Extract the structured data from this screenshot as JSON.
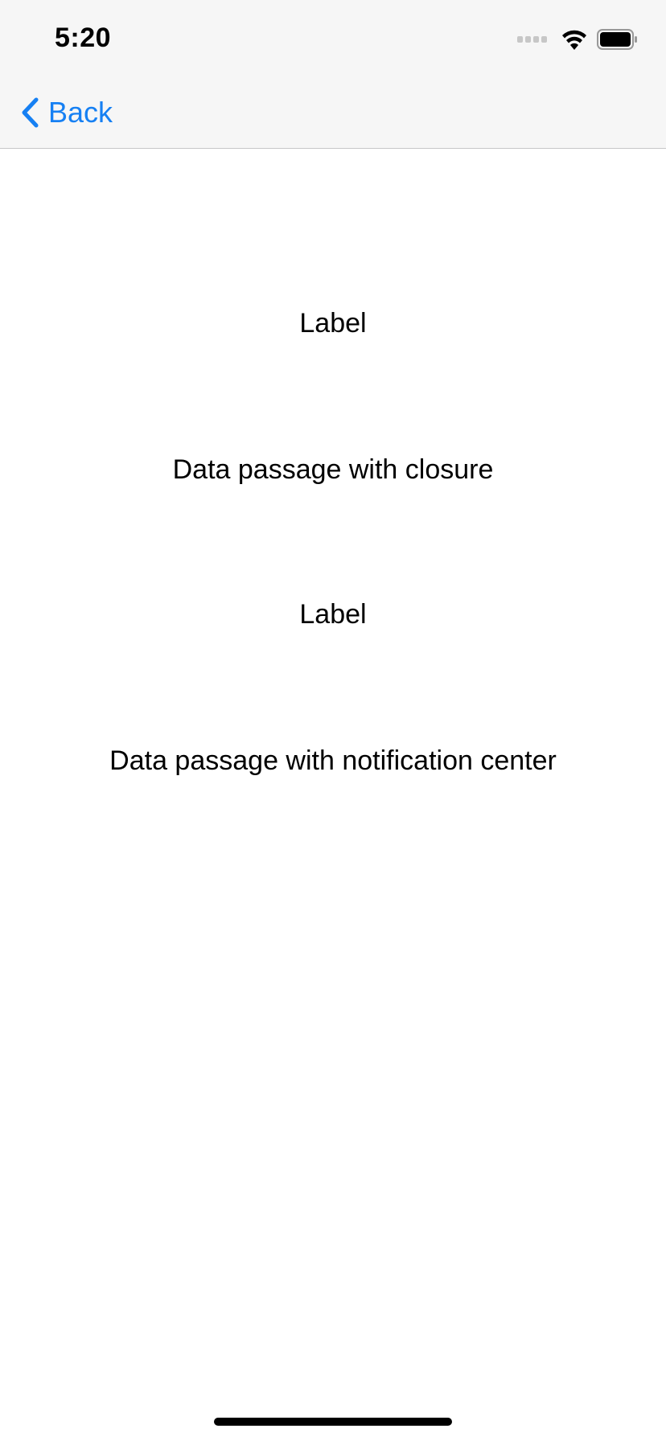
{
  "status_bar": {
    "time": "5:20",
    "icons": [
      "cellular-signal-icon",
      "wifi-icon",
      "battery-icon"
    ]
  },
  "nav_bar": {
    "back_label": "Back",
    "back_icon": "chevron-left-icon",
    "accent_color": "#1680f3"
  },
  "main": {
    "items": [
      {
        "text": "Label"
      },
      {
        "text": "Data passage with closure"
      },
      {
        "text": "Label"
      },
      {
        "text": "Data passage with notification center"
      }
    ]
  }
}
